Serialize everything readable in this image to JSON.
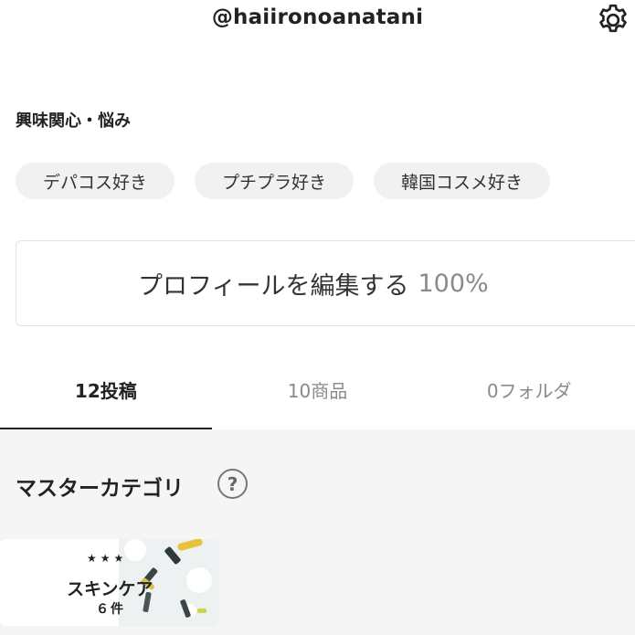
{
  "header": {
    "username": "@haiironoanatani",
    "settings_icon": "gear-icon"
  },
  "interests": {
    "title": "興味関心・悩み",
    "tags": [
      "デパコス好き",
      "プチプラ好き",
      "韓国コスメ好き"
    ]
  },
  "edit_profile": {
    "label": "プロフィールを編集する",
    "completion": "100%"
  },
  "tabs": [
    {
      "label": "12投稿",
      "active": true
    },
    {
      "label": "10商品",
      "active": false
    },
    {
      "label": "0フォルダ",
      "active": false
    }
  ],
  "master_category": {
    "title": "マスターカテゴリ",
    "help_icon": "question-circle-icon",
    "help_glyph": "?",
    "card": {
      "stars": "★★★",
      "name": "スキンケア",
      "count": "６件"
    }
  },
  "colors": {
    "accent_text": "#222222",
    "muted_text": "#8a8a8a",
    "tag_bg": "#f1f1f1",
    "content_bg": "#f5f5f5"
  }
}
